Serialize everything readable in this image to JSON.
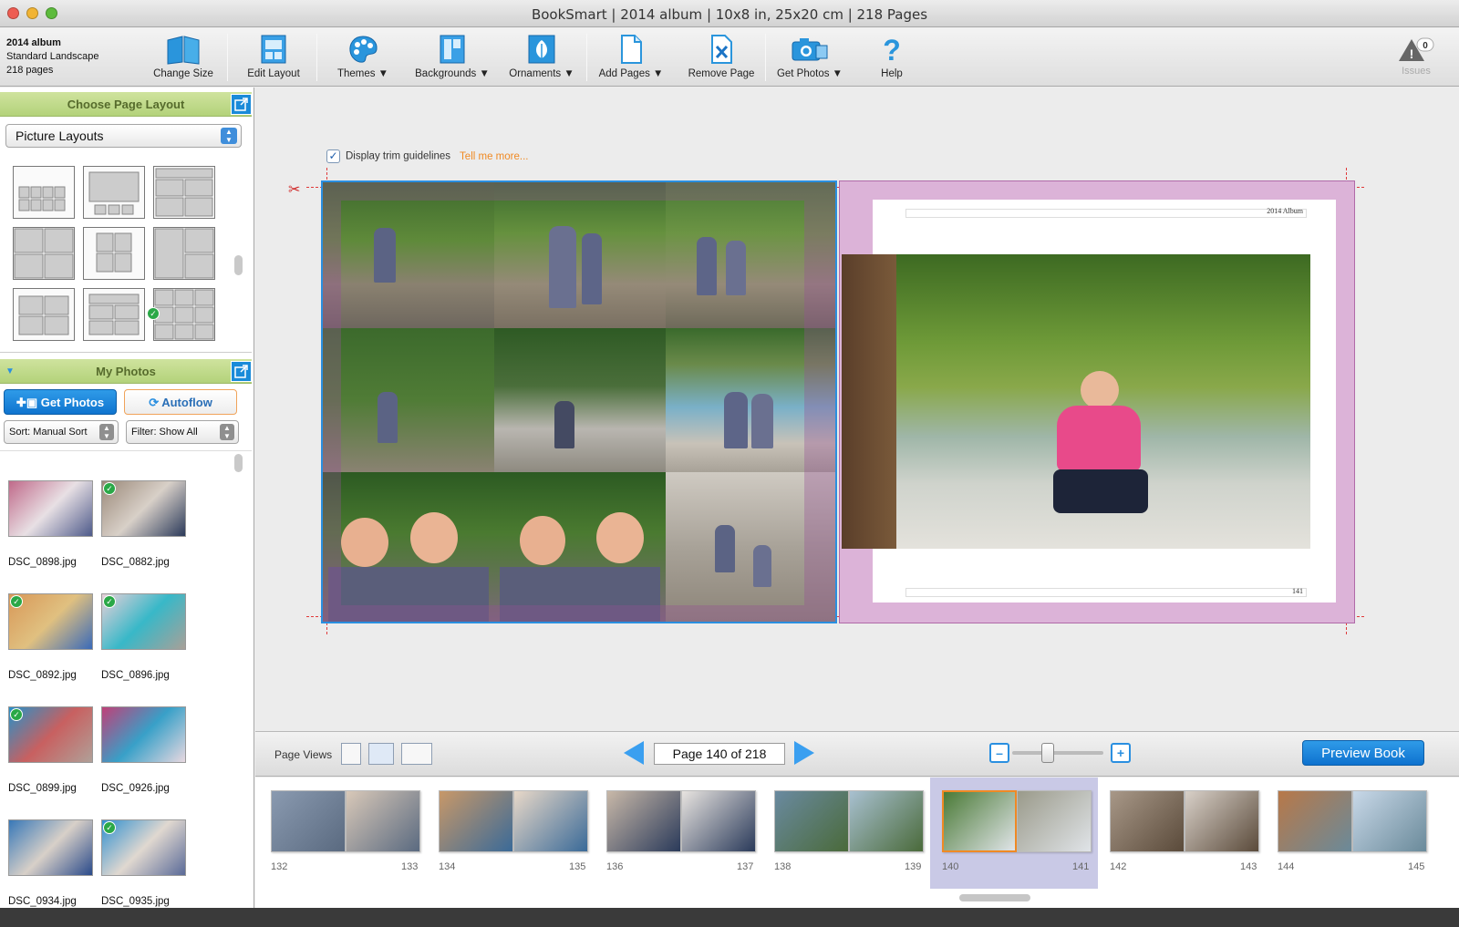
{
  "window": {
    "title": "BookSmart  |  2014 album  |  10x8 in, 25x20 cm  |  218 Pages"
  },
  "album": {
    "name": "2014 album",
    "format": "Standard Landscape",
    "pages": "218 pages"
  },
  "toolbar": {
    "change_size": "Change Size",
    "edit_layout": "Edit Layout",
    "themes": "Themes ▼",
    "backgrounds": "Backgrounds ▼",
    "ornaments": "Ornaments ▼",
    "add_pages": "Add Pages ▼",
    "remove_page": "Remove Page",
    "get_photos": "Get Photos ▼",
    "help": "Help",
    "issues_count": "0",
    "issues": "Issues"
  },
  "layout_panel": {
    "title": "Choose Page Layout",
    "select_value": "Picture Layouts"
  },
  "photos_panel": {
    "title": "My Photos",
    "get_photos": "Get Photos",
    "autoflow": "Autoflow",
    "sort_value": "Sort:  Manual Sort",
    "filter_value": "Filter: Show All",
    "photos": [
      {
        "name": "DSC_0898.jpg",
        "used": false,
        "colors": [
          "#c06a8a",
          "#e8e0e4",
          "#4e5a8a"
        ]
      },
      {
        "name": "DSC_0882.jpg",
        "used": true,
        "colors": [
          "#9a8878",
          "#d8d0c8",
          "#2c3a5a"
        ]
      },
      {
        "name": "DSC_0892.jpg",
        "used": true,
        "colors": [
          "#d89858",
          "#e0c080",
          "#3a6ab8"
        ]
      },
      {
        "name": "DSC_0896.jpg",
        "used": true,
        "colors": [
          "#e8d0d8",
          "#38b8c8",
          "#a8a098"
        ]
      },
      {
        "name": "DSC_0899.jpg",
        "used": true,
        "colors": [
          "#2890c8",
          "#c86060",
          "#b0a098"
        ]
      },
      {
        "name": "DSC_0926.jpg",
        "used": false,
        "colors": [
          "#c04078",
          "#38a0c8",
          "#e8d8e0"
        ]
      },
      {
        "name": "DSC_0934.jpg",
        "used": false,
        "colors": [
          "#3878b8",
          "#d8d0c8",
          "#2a4a8a"
        ]
      },
      {
        "name": "DSC_0935.jpg",
        "used": true,
        "colors": [
          "#3090d0",
          "#e0d8d0",
          "#5a6a98"
        ]
      }
    ]
  },
  "workspace": {
    "trim_label": "Display trim guidelines",
    "trim_checked": true,
    "tell_more": "Tell me more...",
    "right_header": "2014 Album",
    "right_page_number": "141"
  },
  "bottombar": {
    "page_views": "Page Views",
    "page_indicator": "Page 140 of 218",
    "zoom_out": "–",
    "zoom_in": "+",
    "preview": "Preview Book"
  },
  "filmstrip": [
    {
      "left": "132",
      "right": "133",
      "selected": false
    },
    {
      "left": "134",
      "right": "135",
      "selected": false
    },
    {
      "left": "136",
      "right": "137",
      "selected": false
    },
    {
      "left": "138",
      "right": "139",
      "selected": false
    },
    {
      "left": "140",
      "right": "141",
      "selected": true
    },
    {
      "left": "142",
      "right": "143",
      "selected": false
    },
    {
      "left": "144",
      "right": "145",
      "selected": false
    }
  ],
  "colors": {
    "accent_blue": "#1a8bd9",
    "panel_green": "#b3d27a",
    "trim_red": "#e0393a",
    "page_pink": "#dcb3d8",
    "selected_spread": "#c9c9e6"
  }
}
